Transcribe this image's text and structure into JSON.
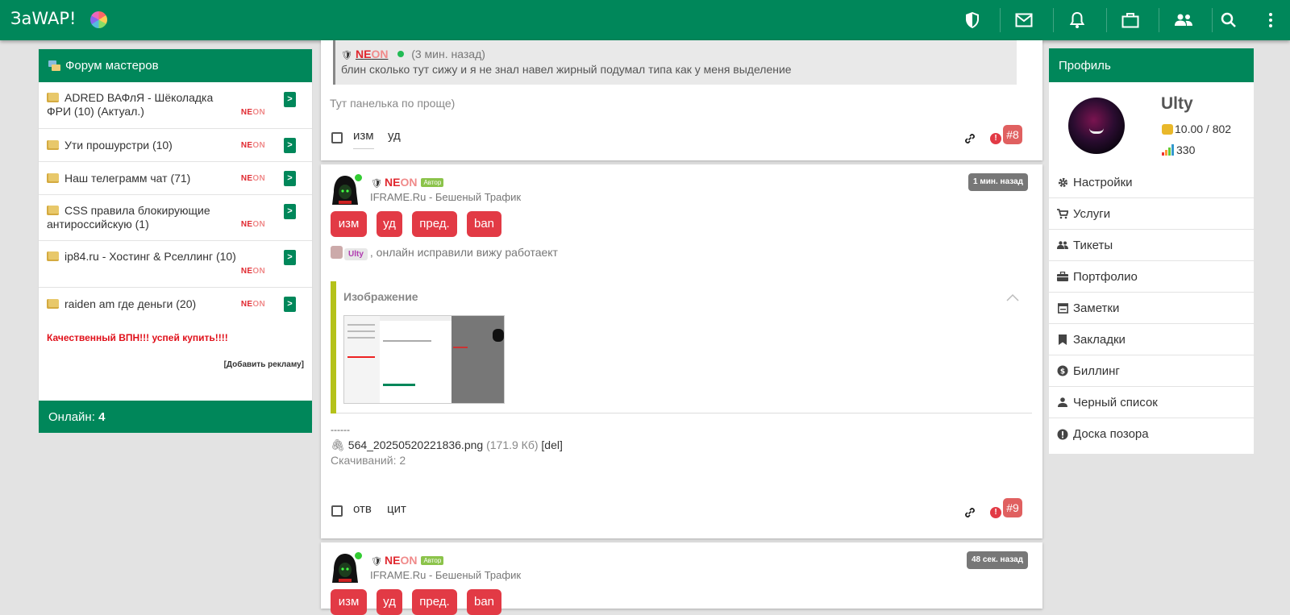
{
  "app": {
    "brand": "ЗаWAP!"
  },
  "forum": {
    "title": "Форум мастеров",
    "topics": [
      {
        "title": "ADRED ВАФлЯ - Шёколадка ФРИ (10) (Актуал.)"
      },
      {
        "title": "Ути прошурстри (10)"
      },
      {
        "title": "Наш телеграмм чат (71)"
      },
      {
        "title": "CSS правила блокирующие антироссийскую (1)"
      },
      {
        "title": "ip84.ru - Хостинг & Рселлинг (10)"
      },
      {
        "title": "raiden am где деньги (20)"
      }
    ],
    "neon_parts": [
      "N",
      "E",
      "ON"
    ],
    "go_label": ">",
    "ad_text": "Качественный ВПН!!! успей купить!!!!",
    "add_ad": "[Добавить рекламу]",
    "online_label": "Онлайн:",
    "online_count": "4"
  },
  "posts": {
    "quote": {
      "author_parts": [
        "N",
        "E",
        "ON"
      ],
      "time": "(3 мин. назад)",
      "text": "блин сколько тут сижу и я не знал навел жирный подумал типа как у меня выделение"
    },
    "post8": {
      "text": "Тут панелька по проще)",
      "action1": "изм",
      "action2": "уд",
      "number": "#8"
    },
    "post9": {
      "author_parts": [
        "N",
        "E",
        "ON"
      ],
      "author_badge": "Автор",
      "subtitle": "IFRAME.Ru - Бешеный Трафик",
      "time": "1 мин. назад",
      "buttons": [
        "изм",
        "уд",
        "пред.",
        "ban"
      ],
      "mention": "Ulty",
      "text": ", онлайн исправили вижу работаект",
      "spoiler_title": "Изображение",
      "separator": "------",
      "file_name": "564_20250520221836.png",
      "file_size": "(171.9 Кб)",
      "file_del": "[del]",
      "downloads": "Скачиваний: 2",
      "action1": "отв",
      "action2": "цит",
      "number": "#9"
    },
    "post10": {
      "author_parts": [
        "N",
        "E",
        "ON"
      ],
      "author_badge": "Автор",
      "subtitle": "IFRAME.Ru - Бешеный Трафик",
      "time": "48 сек. назад",
      "buttons": [
        "изм",
        "уд",
        "пред.",
        "ban"
      ]
    }
  },
  "profile": {
    "title": "Профиль",
    "username": "Ulty",
    "balance": "10.00 / 802",
    "rating": "330",
    "menu": [
      {
        "label": "Настройки",
        "icon": "gear-icon"
      },
      {
        "label": "Услуги",
        "icon": "cart-icon"
      },
      {
        "label": "Тикеты",
        "icon": "people-icon"
      },
      {
        "label": "Портфолио",
        "icon": "briefcase-icon"
      },
      {
        "label": "Заметки",
        "icon": "calendar-icon"
      },
      {
        "label": "Закладки",
        "icon": "bookmark-icon"
      },
      {
        "label": "Биллинг",
        "icon": "coin-icon"
      },
      {
        "label": "Черный список",
        "icon": "person-icon"
      },
      {
        "label": "Доска позора",
        "icon": "alert-icon"
      }
    ]
  },
  "colors": {
    "brand": "#00875a",
    "danger": "#e23a45",
    "neon_red": "#e0282f"
  }
}
